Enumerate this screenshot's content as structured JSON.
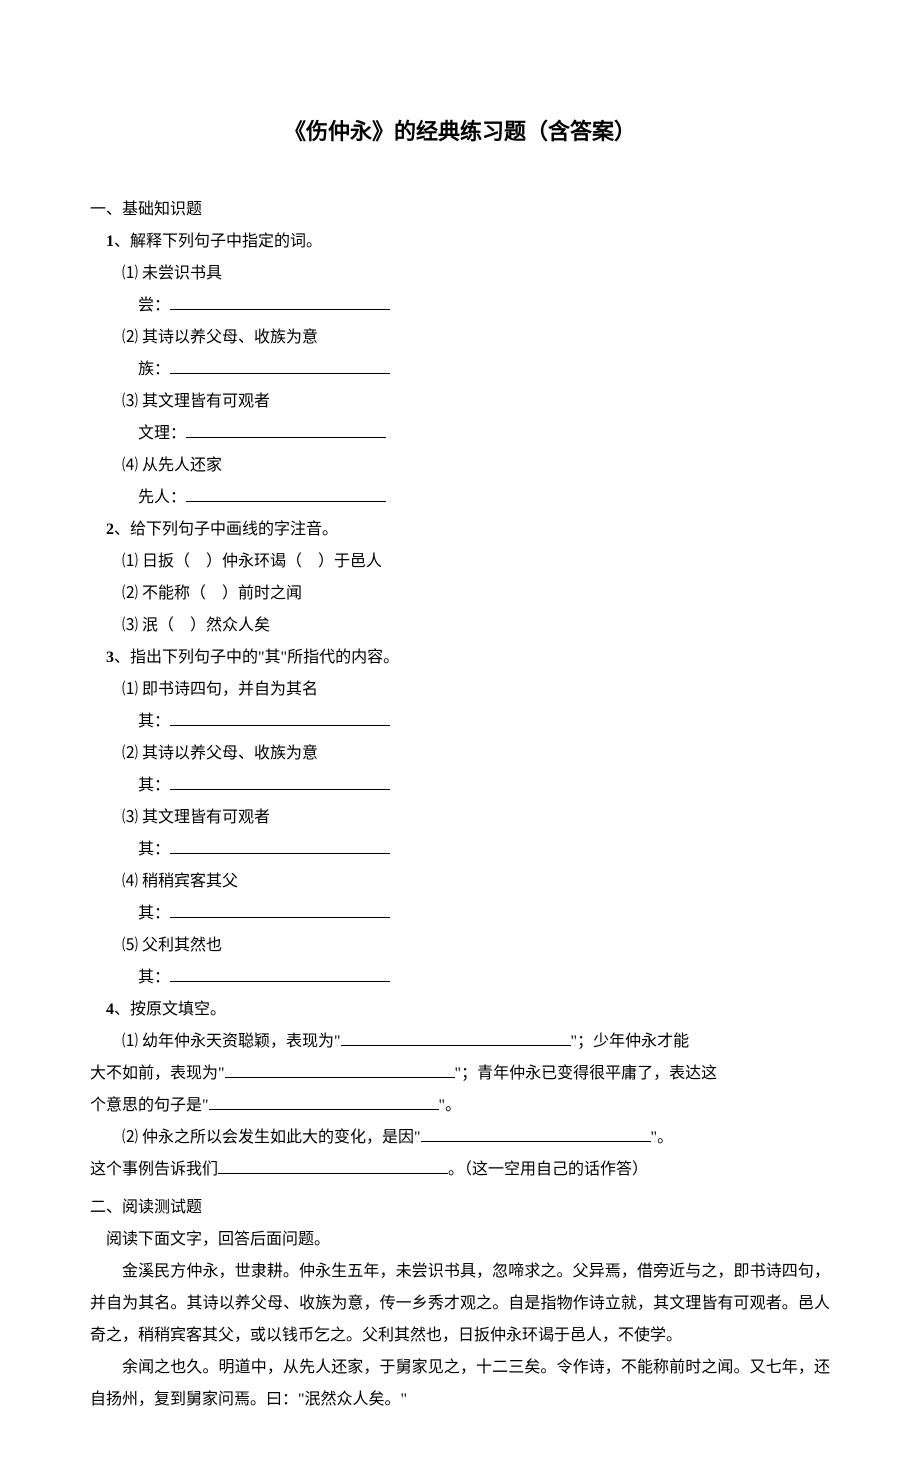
{
  "title": "《伤仲永》的经典练习题（含答案）",
  "section1_head": "一、基础知识题",
  "q1": {
    "num": "1",
    "text": "、解释下列句子中指定的词。"
  },
  "q1_1": {
    "label": "⑴ 未尝识书具",
    "field": "尝："
  },
  "q1_2": {
    "label": "⑵ 其诗以养父母、收族为意",
    "field": "族："
  },
  "q1_3": {
    "label": "⑶ 其文理皆有可观者",
    "field": "文理："
  },
  "q1_4": {
    "label": "⑷ 从先人还家",
    "field": "先人："
  },
  "q2": {
    "num": "2",
    "text": "、给下列句子中画线的字注音。"
  },
  "q2_1": "⑴ 日扳（　）仲永环谒（　）于邑人",
  "q2_2": "⑵ 不能称（　）前时之闻",
  "q2_3": "⑶ 泯（　）然众人矣",
  "q3": {
    "num": "3",
    "text": "、指出下列句子中的\"其\"所指代的内容。"
  },
  "q3_1": {
    "label": "⑴ 即书诗四句，并自为其名",
    "field": "其："
  },
  "q3_2": {
    "label": "⑵ 其诗以养父母、收族为意",
    "field": "其："
  },
  "q3_3": {
    "label": "⑶ 其文理皆有可观者",
    "field": "其："
  },
  "q3_4": {
    "label": "⑷ 稍稍宾客其父",
    "field": "其："
  },
  "q3_5": {
    "label": "⑸ 父利其然也",
    "field": "其："
  },
  "q4": {
    "num": "4",
    "text": "、按原文填空。"
  },
  "q4_1a": "⑴ 幼年仲永天资聪颖，表现为\"",
  "q4_1b": "\"；少年仲永才能",
  "q4_1c": "大不如前，表现为\"",
  "q4_1d": "\"；青年仲永已变得很平庸了，表达这",
  "q4_1e": "个意思的句子是\"",
  "q4_1f": "\"。",
  "q4_2a": "⑵ 仲永之所以会发生如此大的变化，是因\"",
  "q4_2b": "\"。",
  "q4_2c": "这个事例告诉我们",
  "q4_2d": "。（这一空用自己的话作答）",
  "section2_head": "二、阅读测试题",
  "read_instr": "阅读下面文字，回答后面问题。",
  "passage1": "金溪民方仲永，世隶耕。仲永生五年，未尝识书具，忽啼求之。父异焉，借旁近与之，即书诗四句，并自为其名。其诗以养父母、收族为意，传一乡秀才观之。自是指物作诗立就，其文理皆有可观者。邑人奇之，稍稍宾客其父，或以钱币乞之。父利其然也，日扳仲永环谒于邑人，不使学。",
  "passage2": "余闻之也久。明道中，从先人还家，于舅家见之，十二三矣。令作诗，不能称前时之闻。又七年，还自扬州，复到舅家问焉。曰：\"泯然众人矣。\""
}
